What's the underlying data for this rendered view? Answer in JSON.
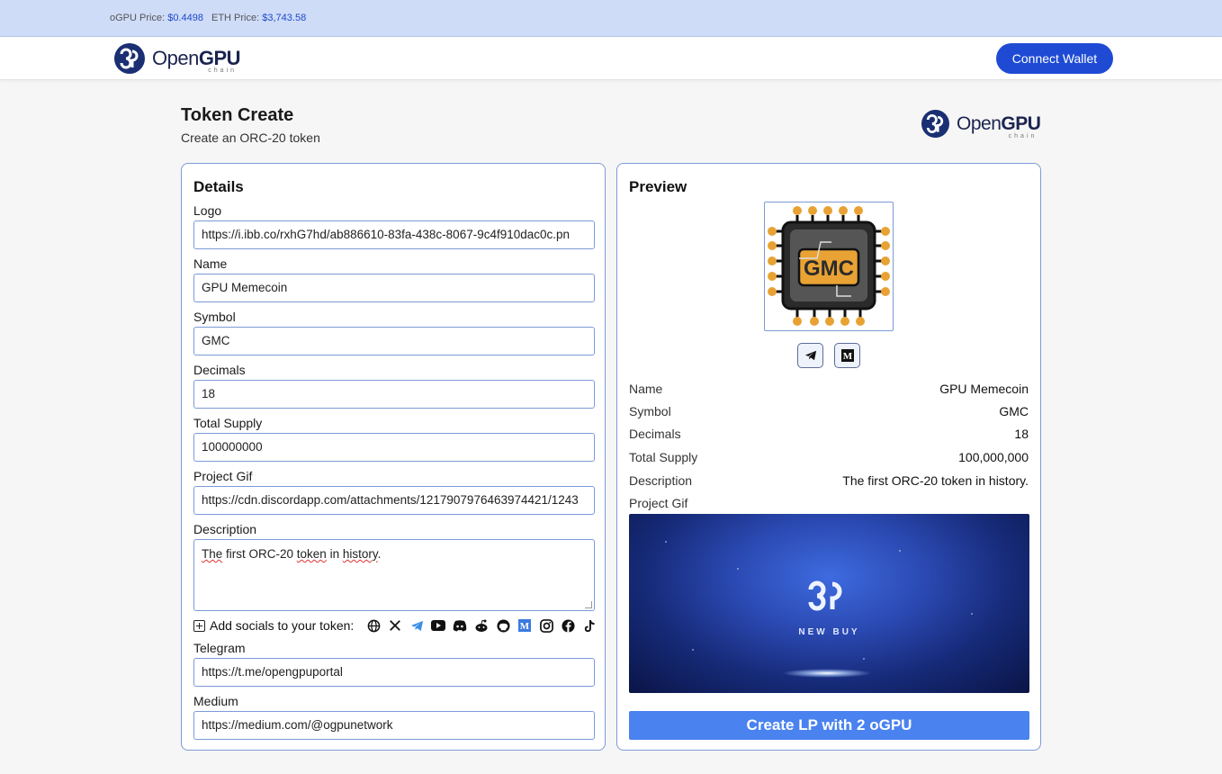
{
  "ticker": {
    "ogpu_label": "oGPU Price:",
    "ogpu_value": "$0.4498",
    "eth_label": "ETH Price:",
    "eth_value": "$3,743.58"
  },
  "brand": {
    "name_regular": "Open",
    "name_bold": "GPU",
    "tagline": "chain"
  },
  "nav": {
    "connect_label": "Connect Wallet"
  },
  "page": {
    "title": "Token Create",
    "subtitle": "Create an ORC-20 token"
  },
  "details": {
    "heading": "Details",
    "fields": {
      "logo": {
        "label": "Logo",
        "value": "https://i.ibb.co/rxhG7hd/ab886610-83fa-438c-8067-9c4f910dac0c.pn"
      },
      "name": {
        "label": "Name",
        "value": "GPU Memecoin"
      },
      "symbol": {
        "label": "Symbol",
        "value": "GMC"
      },
      "decimals": {
        "label": "Decimals",
        "value": "18"
      },
      "total_supply": {
        "label": "Total Supply",
        "value": "100000000"
      },
      "project_gif": {
        "label": "Project Gif",
        "value": "https://cdn.discordapp.com/attachments/1217907976463974421/1243"
      },
      "description": {
        "label": "Description",
        "w1": "The",
        "w2": " first ORC-20 ",
        "w3": "token",
        "w4": " in ",
        "w5": "history",
        "w6": "."
      },
      "telegram": {
        "label": "Telegram",
        "value": "https://t.me/opengpuportal"
      },
      "medium": {
        "label": "Medium",
        "value": "https://medium.com/@ogpunetwork"
      }
    },
    "socials_label": "Add socials to your token:",
    "social_icons": [
      "globe-icon",
      "x-icon",
      "telegram-icon",
      "youtube-icon",
      "discord-icon",
      "reddit-icon",
      "github-icon",
      "medium-icon",
      "instagram-icon",
      "facebook-icon",
      "tiktok-icon"
    ],
    "accent_color": "#7d9ad8"
  },
  "preview": {
    "heading": "Preview",
    "logo_text": "GMC",
    "rows": [
      {
        "key": "Name",
        "value": "GPU Memecoin"
      },
      {
        "key": "Symbol",
        "value": "GMC"
      },
      {
        "key": "Decimals",
        "value": "18"
      },
      {
        "key": "Total Supply",
        "value": "100,000,000"
      },
      {
        "key": "Description",
        "value": "The first ORC-20 token in history."
      }
    ],
    "gif_label": "Project Gif",
    "gif_caption": "NEW BUY",
    "create_label": "Create LP with 2 oGPU",
    "button_color": "#4a82f0"
  }
}
